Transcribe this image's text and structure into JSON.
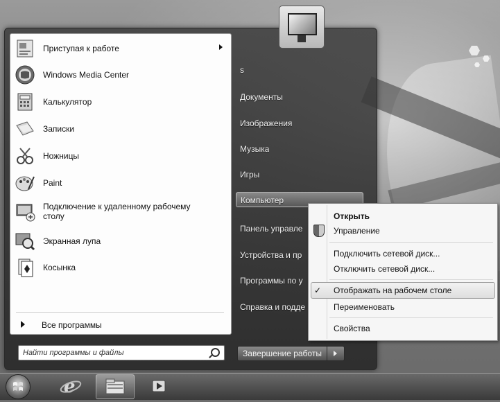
{
  "programs": [
    {
      "label": "Приступая к работе",
      "icon": "getting-started-icon",
      "has_submenu": true
    },
    {
      "label": "Windows Media Center",
      "icon": "media-center-icon"
    },
    {
      "label": "Калькулятор",
      "icon": "calculator-icon"
    },
    {
      "label": "Записки",
      "icon": "sticky-notes-icon"
    },
    {
      "label": "Ножницы",
      "icon": "snipping-tool-icon"
    },
    {
      "label": "Paint",
      "icon": "paint-icon"
    },
    {
      "label_line1": "Подключение к удаленному рабочему",
      "label_line2": "столу",
      "icon": "remote-desktop-icon"
    },
    {
      "label": "Экранная лупа",
      "icon": "magnifier-icon"
    },
    {
      "label": "Косынка",
      "icon": "solitaire-icon"
    }
  ],
  "all_programs": "Все программы",
  "search": {
    "placeholder": "Найти программы и файлы"
  },
  "right_items": [
    {
      "label": "s"
    },
    {
      "label": "Документы"
    },
    {
      "label": "Изображения"
    },
    {
      "label": "Музыка"
    },
    {
      "label": "Игры"
    },
    {
      "label": "Компьютер"
    },
    {
      "label": "Панель управле"
    },
    {
      "label": "Устройства и пр"
    },
    {
      "label": "Программы по у"
    },
    {
      "label": "Справка и подде"
    }
  ],
  "shutdown": {
    "label": "Завершение работы"
  },
  "context_menu": {
    "items": [
      {
        "label": "Открыть",
        "bold": true
      },
      {
        "label": "Управление",
        "icon": "shield-icon"
      },
      {
        "label": "Подключить сетевой диск..."
      },
      {
        "label": "Отключить сетевой диск..."
      },
      {
        "label": "Отображать на рабочем столе",
        "checked": true,
        "highlighted": true
      },
      {
        "label": "Переименовать"
      },
      {
        "label": "Свойства"
      }
    ],
    "check_mark": "✓"
  }
}
